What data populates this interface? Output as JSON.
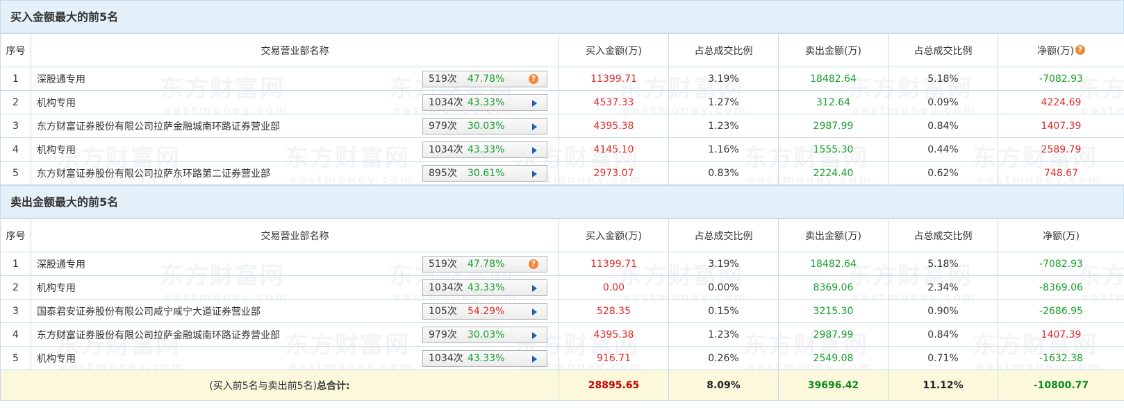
{
  "buy_section": {
    "title": "买入金额最大的前5名",
    "headers": [
      "序号",
      "交易营业部名称",
      "买入金额(万)",
      "占总成交比例",
      "卖出金额(万)",
      "占总成交比例",
      "净额(万)"
    ],
    "rows": [
      {
        "no": "1",
        "name": "深股通专用",
        "count": "519次",
        "pct": "47.78%",
        "pct_color": "#179f2c",
        "indicator": "question-icon",
        "buy": "11399.71",
        "buy_ratio": "3.19%",
        "sell": "18482.64",
        "sell_ratio": "5.18%",
        "net": "-7082.93",
        "net_color": "#179f2c"
      },
      {
        "no": "2",
        "name": "机构专用",
        "count": "1034次",
        "pct": "43.33%",
        "pct_color": "#179f2c",
        "indicator": "arrow-right-icon",
        "buy": "4537.33",
        "buy_ratio": "1.27%",
        "sell": "312.64",
        "sell_ratio": "0.09%",
        "net": "4224.69",
        "net_color": "#e12b2b"
      },
      {
        "no": "3",
        "name": "东方财富证券股份有限公司拉萨金融城南环路证券营业部",
        "count": "979次",
        "pct": "30.03%",
        "pct_color": "#179f2c",
        "indicator": "arrow-right-icon",
        "buy": "4395.38",
        "buy_ratio": "1.23%",
        "sell": "2987.99",
        "sell_ratio": "0.84%",
        "net": "1407.39",
        "net_color": "#e12b2b"
      },
      {
        "no": "4",
        "name": "机构专用",
        "count": "1034次",
        "pct": "43.33%",
        "pct_color": "#179f2c",
        "indicator": "arrow-right-icon",
        "buy": "4145.10",
        "buy_ratio": "1.16%",
        "sell": "1555.30",
        "sell_ratio": "0.44%",
        "net": "2589.79",
        "net_color": "#e12b2b"
      },
      {
        "no": "5",
        "name": "东方财富证券股份有限公司拉萨东环路第二证券营业部",
        "count": "895次",
        "pct": "30.61%",
        "pct_color": "#179f2c",
        "indicator": "arrow-right-icon",
        "buy": "2973.07",
        "buy_ratio": "0.83%",
        "sell": "2224.40",
        "sell_ratio": "0.62%",
        "net": "748.67",
        "net_color": "#e12b2b"
      }
    ]
  },
  "sell_section": {
    "title": "卖出金额最大的前5名",
    "headers": [
      "序号",
      "交易营业部名称",
      "买入金额(万)",
      "占总成交比例",
      "卖出金额(万)",
      "占总成交比例",
      "净额(万)"
    ],
    "rows": [
      {
        "no": "1",
        "name": "深股通专用",
        "count": "519次",
        "pct": "47.78%",
        "pct_color": "#179f2c",
        "indicator": "question-icon",
        "buy": "11399.71",
        "buy_ratio": "3.19%",
        "sell": "18482.64",
        "sell_ratio": "5.18%",
        "net": "-7082.93",
        "net_color": "#179f2c"
      },
      {
        "no": "2",
        "name": "机构专用",
        "count": "1034次",
        "pct": "43.33%",
        "pct_color": "#179f2c",
        "indicator": "arrow-right-icon",
        "buy": "0.00",
        "buy_ratio": "0.00%",
        "sell": "8369.06",
        "sell_ratio": "2.34%",
        "net": "-8369.06",
        "net_color": "#179f2c"
      },
      {
        "no": "3",
        "name": "国泰君安证券股份有限公司咸宁咸宁大道证券营业部",
        "count": "105次",
        "pct": "54.29%",
        "pct_color": "#e12b2b",
        "indicator": "arrow-right-icon",
        "buy": "528.35",
        "buy_ratio": "0.15%",
        "sell": "3215.30",
        "sell_ratio": "0.90%",
        "net": "-2686.95",
        "net_color": "#179f2c"
      },
      {
        "no": "4",
        "name": "东方财富证券股份有限公司拉萨金融城南环路证券营业部",
        "count": "979次",
        "pct": "30.03%",
        "pct_color": "#179f2c",
        "indicator": "arrow-right-icon",
        "buy": "4395.38",
        "buy_ratio": "1.23%",
        "sell": "2987.99",
        "sell_ratio": "0.84%",
        "net": "1407.39",
        "net_color": "#e12b2b"
      },
      {
        "no": "5",
        "name": "机构专用",
        "count": "1034次",
        "pct": "43.33%",
        "pct_color": "#179f2c",
        "indicator": "arrow-right-icon",
        "buy": "916.71",
        "buy_ratio": "0.26%",
        "sell": "2549.08",
        "sell_ratio": "0.71%",
        "net": "-1632.38",
        "net_color": "#179f2c"
      }
    ]
  },
  "total": {
    "label_prefix": "(买入前5名与卖出前5名)",
    "label_main": "总合计:",
    "buy": "28895.65",
    "buy_ratio": "8.09%",
    "sell": "39696.42",
    "sell_ratio": "11.12%",
    "net": "-10800.77"
  },
  "watermark": {
    "cn": "东方财富网",
    "en": "eastmoney.com"
  },
  "colors": {
    "up": "#e12b2b",
    "down": "#179f2c",
    "header_bg": "#e4f0fa",
    "total_bg": "#fbf8dc",
    "border": "#c7dbeb"
  }
}
